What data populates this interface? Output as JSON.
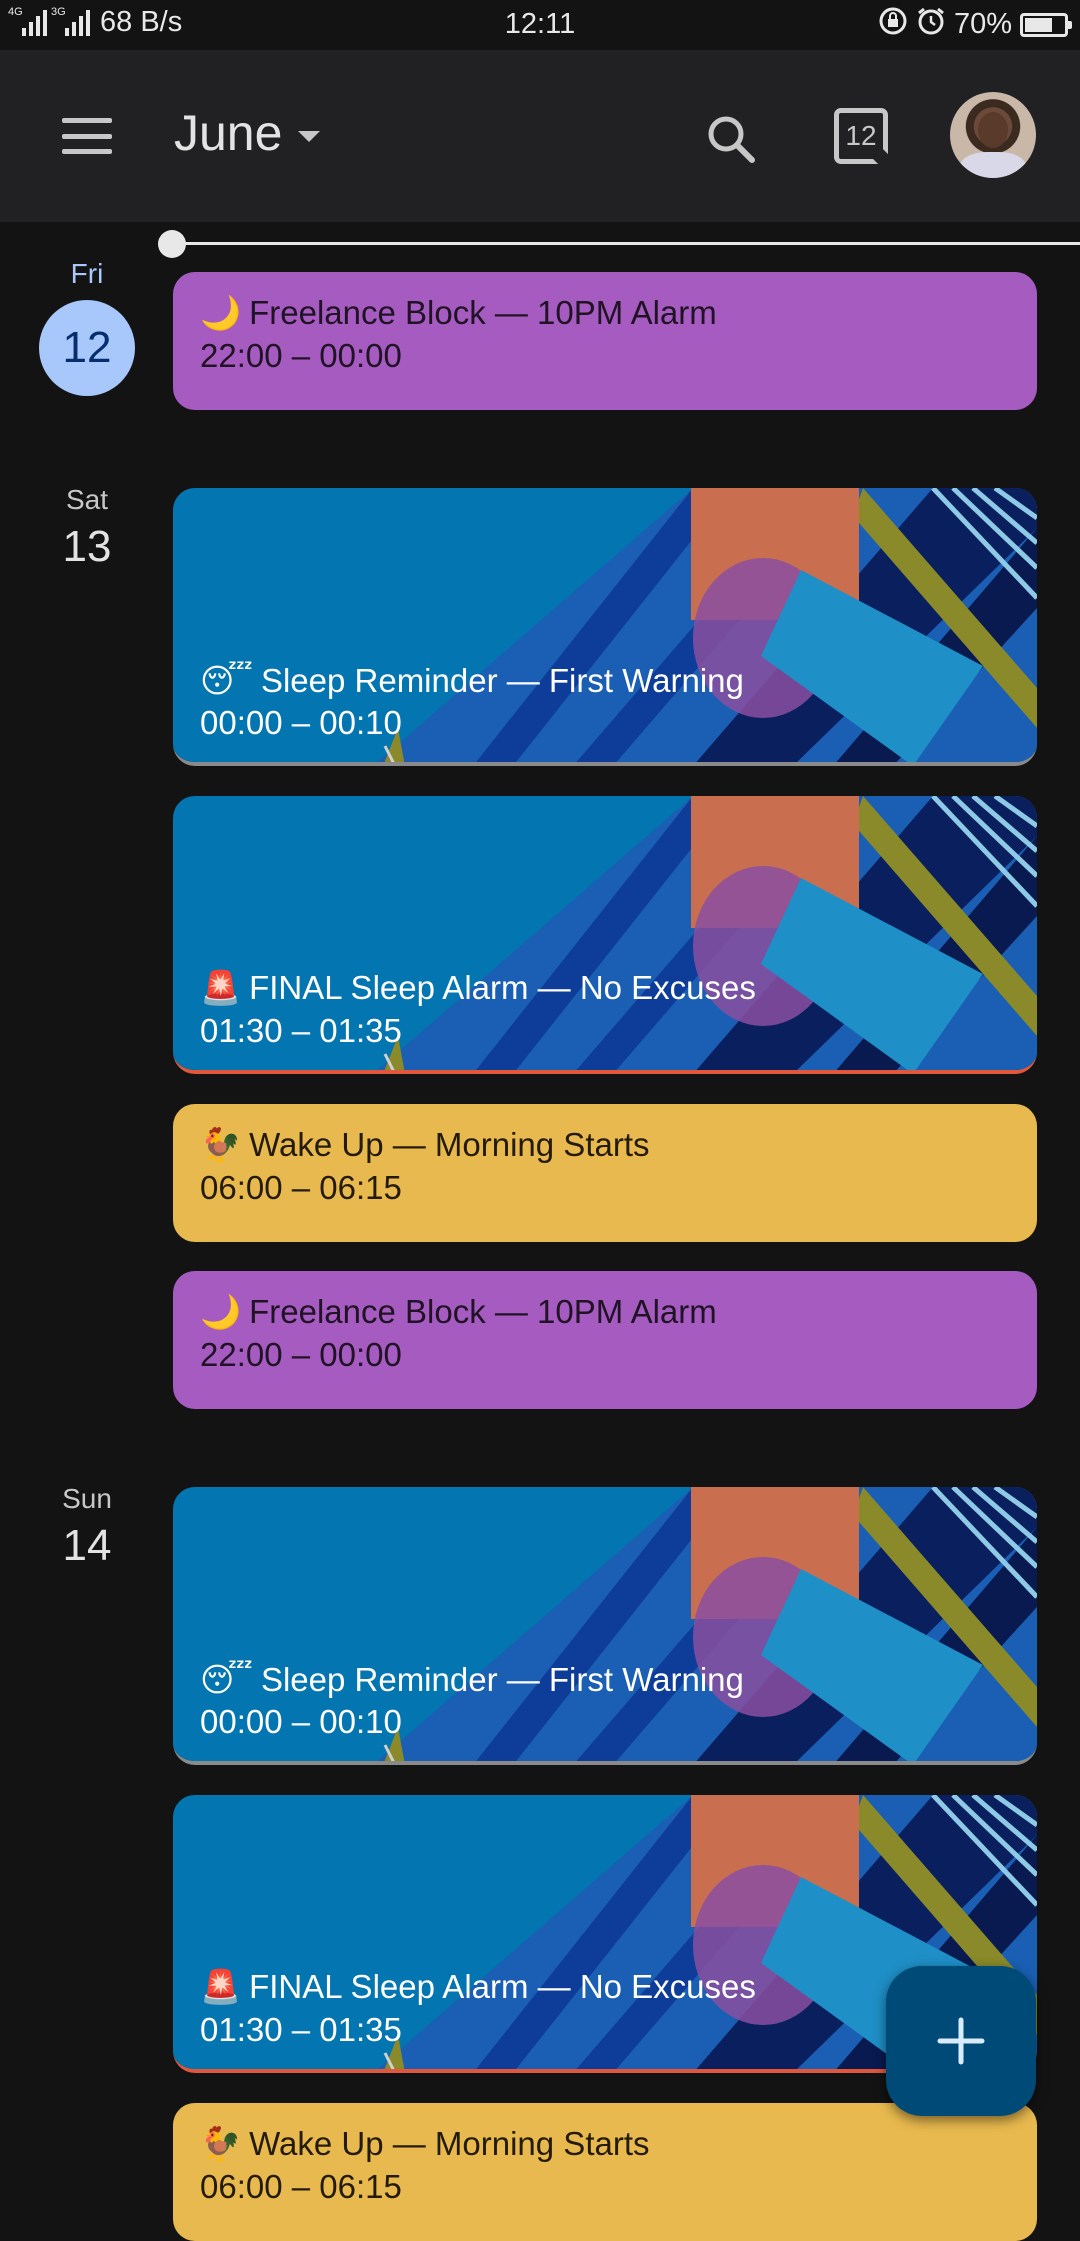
{
  "status_bar": {
    "network_left": "4G",
    "network_right": "3G",
    "speed": "68 B/s",
    "time": "12:11",
    "battery": "70%",
    "battery_level": 0.7
  },
  "app_bar": {
    "month": "June",
    "today_icon_number": "12",
    "icons": [
      "menu-icon",
      "search-icon",
      "today-icon",
      "avatar"
    ]
  },
  "days": [
    {
      "name": "Fri",
      "number": "12",
      "is_today": true
    },
    {
      "name": "Sat",
      "number": "13",
      "is_today": false
    },
    {
      "name": "Sun",
      "number": "14",
      "is_today": false
    }
  ],
  "events": [
    {
      "emoji": "🌙",
      "title": "Freelance Block — 10PM Alarm",
      "time": "22:00 – 00:00",
      "color": "#a55bbf"
    },
    {
      "emoji": "😴",
      "title": "Sleep Reminder — First Warning",
      "time": "00:00 – 00:10",
      "style": "illustration"
    },
    {
      "emoji": "🚨",
      "title": "FINAL Sleep Alarm — No Excuses",
      "time": "01:30 – 01:35",
      "style": "illustration"
    },
    {
      "emoji": "🐓",
      "title": "Wake Up — Morning Starts",
      "time": "06:00 – 06:15",
      "color": "#e8b94e"
    },
    {
      "emoji": "🌙",
      "title": "Freelance Block — 10PM Alarm",
      "time": "22:00 – 00:00",
      "color": "#a55bbf"
    },
    {
      "emoji": "😴",
      "title": "Sleep Reminder — First Warning",
      "time": "00:00 – 00:10",
      "style": "illustration"
    },
    {
      "emoji": "🚨",
      "title": "FINAL Sleep Alarm — No Excuses",
      "time": "01:30 – 01:35",
      "style": "illustration"
    },
    {
      "emoji": "🐓",
      "title": "Wake Up — Morning Starts",
      "time": "06:00 – 06:15",
      "color": "#e8b94e"
    }
  ],
  "fab": {
    "icon": "plus-icon",
    "color": "#004a77"
  },
  "colors": {
    "background": "#131314",
    "app_bar": "#212124",
    "today_circle": "#a8c7fa"
  }
}
